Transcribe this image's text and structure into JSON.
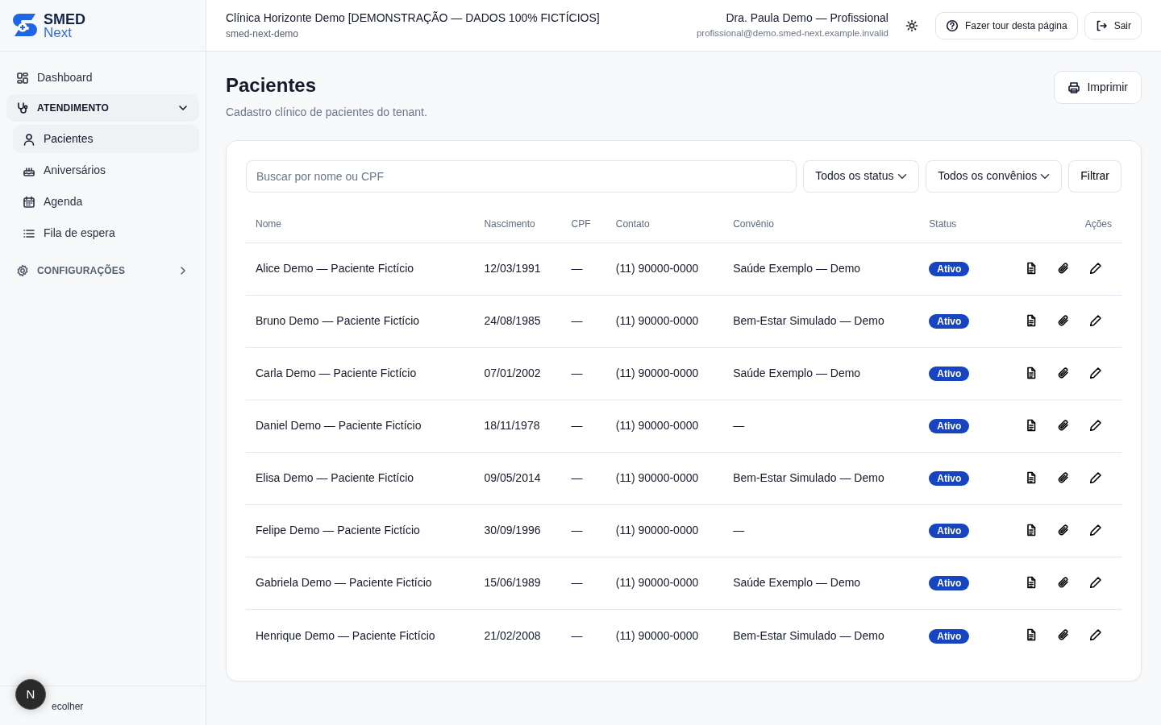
{
  "brand": {
    "name": "SMED",
    "sub": "Next"
  },
  "sidebar": {
    "items": [
      {
        "kind": "link",
        "label": "Dashboard"
      },
      {
        "kind": "section",
        "label": "ATENDIMENTO",
        "expanded": true,
        "children": [
          {
            "label": "Pacientes",
            "selected": true
          },
          {
            "label": "Aniversários",
            "selected": false
          },
          {
            "label": "Agenda",
            "selected": false
          },
          {
            "label": "Fila de espera",
            "selected": false
          }
        ]
      },
      {
        "kind": "section",
        "label": "CONFIGURAÇÕES",
        "expanded": false
      }
    ],
    "collapse_label": "ecolher",
    "avatar": "N"
  },
  "header": {
    "tenant": "Clínica Horizonte Demo [DEMONSTRAÇÃO — DADOS 100% FICTÍCIOS]",
    "tenant_slug": "smed-next-demo",
    "user": "Dra. Paula Demo — Profissional",
    "email": "profissional@demo.smed-next.example.invalid",
    "buttons": [
      {
        "label": "Fazer tour desta página"
      },
      {
        "label": "Sair"
      }
    ]
  },
  "page": {
    "title": "Pacientes",
    "subtitle": "Cadastro clínico de pacientes do tenant.",
    "print_button": "Imprimir"
  },
  "filters": {
    "search_placeholder": "Buscar por nome ou CPF",
    "status_select": "Todos os status",
    "plan_select": "Todos os convênios",
    "filter_button": "Filtrar"
  },
  "table": {
    "columns": [
      "Nome",
      "Nascimento",
      "CPF",
      "Contato",
      "Convênio",
      "Status",
      "Ações"
    ],
    "rows": [
      {
        "name": "Alice Demo — Paciente Fictício",
        "birth": "12/03/1991",
        "cpf": "—",
        "contact": "(11) 90000-0000",
        "plan": "Saúde Exemplo — Demo",
        "status": "Ativo"
      },
      {
        "name": "Bruno Demo — Paciente Fictício",
        "birth": "24/08/1985",
        "cpf": "—",
        "contact": "(11) 90000-0000",
        "plan": "Bem-Estar Simulado — Demo",
        "status": "Ativo"
      },
      {
        "name": "Carla Demo — Paciente Fictício",
        "birth": "07/01/2002",
        "cpf": "—",
        "contact": "(11) 90000-0000",
        "plan": "Saúde Exemplo — Demo",
        "status": "Ativo"
      },
      {
        "name": "Daniel Demo — Paciente Fictício",
        "birth": "18/11/1978",
        "cpf": "—",
        "contact": "(11) 90000-0000",
        "plan": "—",
        "status": "Ativo"
      },
      {
        "name": "Elisa Demo — Paciente Fictício",
        "birth": "09/05/2014",
        "cpf": "—",
        "contact": "(11) 90000-0000",
        "plan": "Bem-Estar Simulado — Demo",
        "status": "Ativo"
      },
      {
        "name": "Felipe Demo — Paciente Fictício",
        "birth": "30/09/1996",
        "cpf": "—",
        "contact": "(11) 90000-0000",
        "plan": "—",
        "status": "Ativo"
      },
      {
        "name": "Gabriela Demo — Paciente Fictício",
        "birth": "15/06/1989",
        "cpf": "—",
        "contact": "(11) 90000-0000",
        "plan": "Saúde Exemplo — Demo",
        "status": "Ativo"
      },
      {
        "name": "Henrique Demo — Paciente Fictício",
        "birth": "21/02/2008",
        "cpf": "—",
        "contact": "(11) 90000-0000",
        "plan": "Bem-Estar Simulado — Demo",
        "status": "Ativo"
      }
    ]
  }
}
